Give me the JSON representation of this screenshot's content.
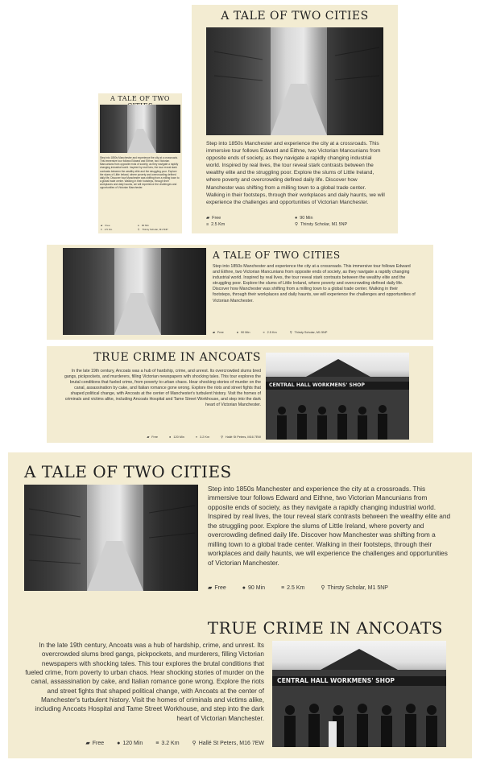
{
  "tour1": {
    "title": "A TALE OF TWO CITIES",
    "description": "Step into 1850s Manchester and experience the city at a crossroads. This immersive tour follows Edward and Eithne, two Victorian Mancunians from opposite ends of society, as they navigate a rapidly changing industrial world. Inspired by real lives, the tour reveal stark contrasts between the wealthy elite and the struggling poor. Explore the slums of Little Ireland, where poverty and overcrowding defined daily life. Discover how Manchester was shifting from a milling town to a global trade center. Walking in their footsteps, through their workplaces and daily haunts, we will experience the challenges and opportunities of Victorian Manchester.",
    "price": "Free",
    "duration": "90 Min",
    "distance": "2.5 Km",
    "location": "Thirsty Scholar, M1 5NP"
  },
  "tour2": {
    "title": "TRUE CRIME IN ANCOATS",
    "description": "In the late 19th century, Ancoats was a hub of hardship, crime, and unrest. Its overcrowded slums bred gangs, pickpockets, and murderers, filling Victorian newspapers with shocking tales. This tour explores the brutal conditions that fueled crime, from poverty to urban chaos. Hear shocking stories of murder on the canal, assassination by cake, and Italian romance gone wrong. Explore the riots and street fights that shaped political change, with Ancoats at the center of Manchester's turbulent history. Visit the homes of criminals and victims alike, including Ancoats Hospital and Tame Street Workhouse, and step into the dark heart of Victorian Manchester.",
    "photo_sign": "CENTRAL HALL WORKMENS' SHOP",
    "price": "Free",
    "duration": "120 Min",
    "distance": "3.2 Km",
    "location": "Hallé St Peters, M16 7EW"
  },
  "icons": {
    "price": "ticket-icon",
    "duration": "clock-icon",
    "distance": "walking-route-icon",
    "location": "map-pin-icon"
  },
  "colors": {
    "card_background": "#f3ecd2",
    "title": "#222222",
    "text": "#333333"
  }
}
